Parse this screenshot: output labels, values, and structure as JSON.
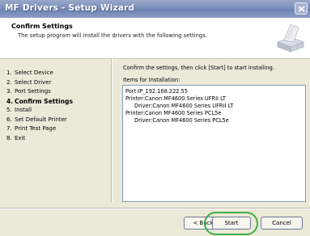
{
  "window": {
    "title": "MF Drivers - Setup Wizard"
  },
  "header": {
    "title": "Confirm Settings",
    "subtitle": "The setup program will install the drivers with the following settings."
  },
  "steps": [
    {
      "num": "1.",
      "label": "Select Device",
      "current": false
    },
    {
      "num": "2.",
      "label": "Select Driver",
      "current": false
    },
    {
      "num": "3.",
      "label": "Port Settings",
      "current": false
    },
    {
      "num": "4.",
      "label": "Confirm Settings",
      "current": true
    },
    {
      "num": "5.",
      "label": "Install",
      "current": false
    },
    {
      "num": "6.",
      "label": "Set Default Printer",
      "current": false
    },
    {
      "num": "7.",
      "label": "Print Test Page",
      "current": false
    },
    {
      "num": "8.",
      "label": "Exit",
      "current": false
    }
  ],
  "main": {
    "instruction": "Confirm the settings, then click [Start] to start installing.",
    "items_label": "Items for Installation:",
    "items": [
      "Port:IP_192.168.222.55",
      "Printer:Canon MF4600 Series UFRII LT",
      "Driver:Canon MF4600 Series UFRII LT",
      "Printer:Canon MF4600 Series PCL5e",
      "Driver:Canon MF4600 Series PCL5e"
    ]
  },
  "buttons": {
    "back": "< Back",
    "start": "Start",
    "cancel": "Cancel"
  },
  "colors": {
    "highlight": "#3db04a",
    "titlebar": "#7b8fbd"
  }
}
